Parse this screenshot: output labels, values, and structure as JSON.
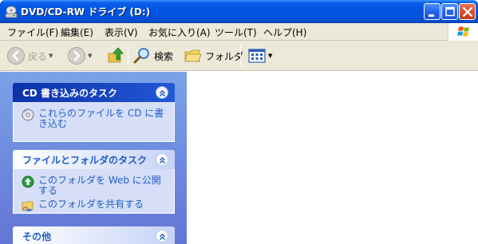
{
  "window": {
    "title": "DVD/CD-RW ドライブ (D:)",
    "icons": {
      "app": "cd-drive-icon",
      "minimize": "minimize-icon",
      "maximize": "maximize-icon",
      "close": "close-icon"
    }
  },
  "menubar": {
    "items": [
      "ファイル(F)",
      "編集(E)",
      "表示(V)",
      "お気に入り(A)",
      "ツール(T)",
      "ヘルプ(H)"
    ]
  },
  "toolbar": {
    "back_label": "戻る",
    "search_label": "検索",
    "folders_label": "フォルダ"
  },
  "taskpane": {
    "groups": [
      {
        "title": "CD 書き込みのタスク",
        "tasks": [
          {
            "label": "これらのファイルを CD に書き込む",
            "icon": "cd-write-icon"
          }
        ]
      },
      {
        "title": "ファイルとフォルダのタスク",
        "tasks": [
          {
            "label": "このフォルダを Web に公開する",
            "icon": "web-publish-icon"
          },
          {
            "label": "このフォルダを共有する",
            "icon": "share-folder-icon"
          }
        ]
      },
      {
        "title": "その他",
        "tasks": []
      }
    ]
  },
  "colors": {
    "titlebar": "#0054e3",
    "menubar": "#ece9d8",
    "taskpane_bg": "#7ba2e7",
    "link": "#215dc6"
  }
}
